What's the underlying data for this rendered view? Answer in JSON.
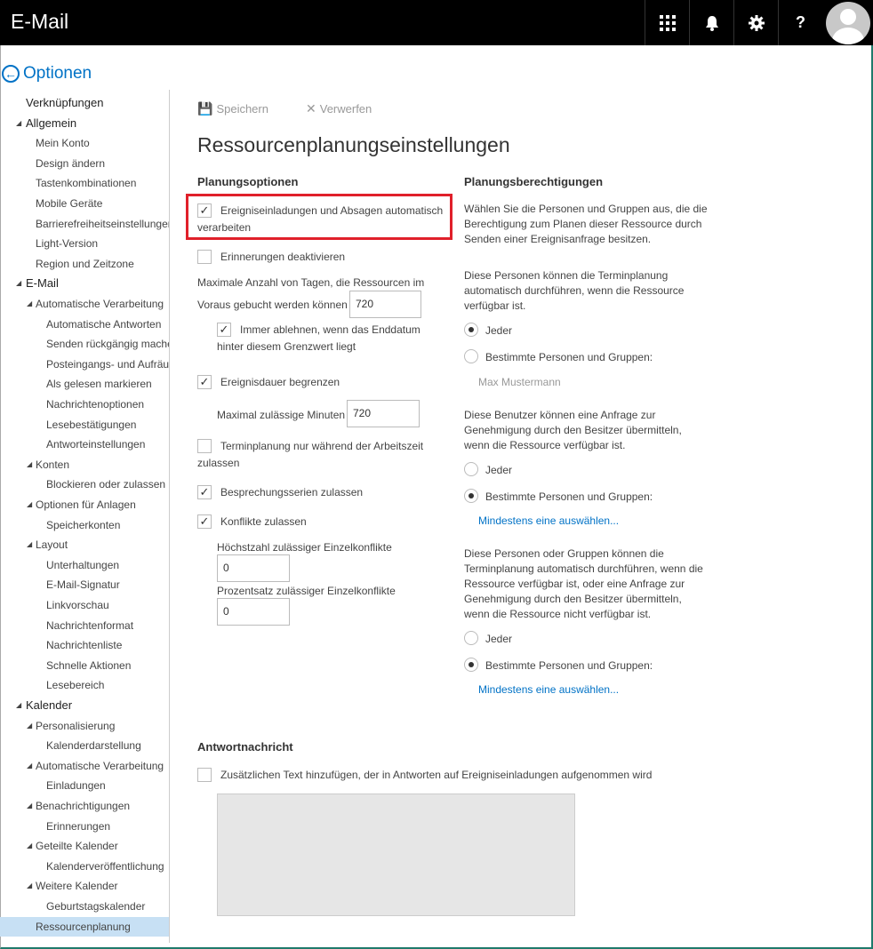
{
  "app": {
    "title": "E-Mail"
  },
  "topbar": {
    "icons": [
      "apps-icon",
      "bell-icon",
      "gear-icon",
      "help-icon",
      "avatar"
    ],
    "help_glyph": "?"
  },
  "header": {
    "back_label": "Optionen"
  },
  "sidebar": {
    "items": [
      {
        "label": "Verknüpfungen",
        "level": 0
      },
      {
        "label": "Allgemein",
        "level": 0,
        "expanded": true
      },
      {
        "label": "Mein Konto",
        "level": 1
      },
      {
        "label": "Design ändern",
        "level": 1
      },
      {
        "label": "Tastenkombinationen",
        "level": 1
      },
      {
        "label": "Mobile Geräte",
        "level": 1
      },
      {
        "label": "Barrierefreiheitseinstellungen",
        "level": 1
      },
      {
        "label": "Light-Version",
        "level": 1
      },
      {
        "label": "Region und Zeitzone",
        "level": 1
      },
      {
        "label": "E-Mail",
        "level": 0,
        "expanded": true
      },
      {
        "label": "Automatische Verarbeitung",
        "level": 1,
        "expanded": true
      },
      {
        "label": "Automatische Antworten",
        "level": 2
      },
      {
        "label": "Senden rückgängig machen",
        "level": 2
      },
      {
        "label": "Posteingangs- und Aufräumregeln",
        "level": 2
      },
      {
        "label": "Als gelesen markieren",
        "level": 2
      },
      {
        "label": "Nachrichtenoptionen",
        "level": 2
      },
      {
        "label": "Lesebestätigungen",
        "level": 2
      },
      {
        "label": "Antworteinstellungen",
        "level": 2
      },
      {
        "label": "Konten",
        "level": 1,
        "expanded": true
      },
      {
        "label": "Blockieren oder zulassen",
        "level": 2
      },
      {
        "label": "Optionen für Anlagen",
        "level": 1,
        "expanded": true
      },
      {
        "label": "Speicherkonten",
        "level": 2
      },
      {
        "label": "Layout",
        "level": 1,
        "expanded": true
      },
      {
        "label": "Unterhaltungen",
        "level": 2
      },
      {
        "label": "E-Mail-Signatur",
        "level": 2
      },
      {
        "label": "Linkvorschau",
        "level": 2
      },
      {
        "label": "Nachrichtenformat",
        "level": 2
      },
      {
        "label": "Nachrichtenliste",
        "level": 2
      },
      {
        "label": "Schnelle Aktionen",
        "level": 2
      },
      {
        "label": "Lesebereich",
        "level": 2
      },
      {
        "label": "Kalender",
        "level": 0,
        "expanded": true
      },
      {
        "label": "Personalisierung",
        "level": 1,
        "expanded": true
      },
      {
        "label": "Kalenderdarstellung",
        "level": 2
      },
      {
        "label": "Automatische Verarbeitung",
        "level": 1,
        "expanded": true
      },
      {
        "label": "Einladungen",
        "level": 2
      },
      {
        "label": "Benachrichtigungen",
        "level": 1,
        "expanded": true
      },
      {
        "label": "Erinnerungen",
        "level": 2
      },
      {
        "label": "Geteilte Kalender",
        "level": 1,
        "expanded": true
      },
      {
        "label": "Kalenderveröffentlichung",
        "level": 2
      },
      {
        "label": "Weitere Kalender",
        "level": 1,
        "expanded": true
      },
      {
        "label": "Geburtstagskalender",
        "level": 2
      },
      {
        "label": "Ressourcenplanung",
        "level": 1,
        "selected": true
      }
    ]
  },
  "toolbar": {
    "save_label": "Speichern",
    "discard_label": "Verwerfen"
  },
  "main": {
    "title": "Ressourcenplanungseinstellungen",
    "planning": {
      "heading": "Planungsoptionen",
      "auto_process_line1": "Ereigniseinladungen und Absagen automatisch",
      "auto_process_line2": "verarbeiten",
      "auto_process_checked": true,
      "disable_reminders": "Erinnerungen deaktivieren",
      "disable_reminders_checked": false,
      "max_days_line1": "Maximale Anzahl von Tagen, die Ressourcen im",
      "max_days_line2": "Voraus gebucht werden können",
      "max_days_value": "720",
      "always_decline_line1": "Immer ablehnen, wenn das Enddatum",
      "always_decline_line2": "hinter diesem Grenzwert liegt",
      "always_decline_checked": true,
      "limit_duration": "Ereignisdauer begrenzen",
      "limit_duration_checked": true,
      "max_minutes_label": "Maximal zulässige Minuten",
      "max_minutes_value": "720",
      "work_hours_line1": "Terminplanung nur während der Arbeitszeit",
      "work_hours_line2": "zulassen",
      "work_hours_checked": false,
      "recurring": "Besprechungsserien zulassen",
      "recurring_checked": true,
      "conflicts": "Konflikte zulassen",
      "conflicts_checked": true,
      "max_conflicts_label": "Höchstzahl zulässiger Einzelkonflikte",
      "max_conflicts_value": "0",
      "percent_conflicts_label": "Prozentsatz zulässiger Einzelkonflikte",
      "percent_conflicts_value": "0"
    },
    "permissions": {
      "heading": "Planungsberechtigungen",
      "intro_1": "Wählen Sie die Personen und Gruppen aus, die die",
      "intro_2": "Berechtigung zum Planen dieser Ressource durch",
      "intro_3": "Senden einer Ereignisanfrage besitzen.",
      "g1_1": "Diese Personen können die Terminplanung",
      "g1_2": "automatisch durchführen, wenn die Ressource",
      "g1_3": "verfügbar ist.",
      "g1_opt1": "Jeder",
      "g1_opt2": "Bestimmte Personen und Gruppen:",
      "g1_selected": "Jeder",
      "g1_person": "Max Mustermann",
      "g2_1": "Diese Benutzer können eine Anfrage zur",
      "g2_2": "Genehmigung durch den Besitzer übermitteln,",
      "g2_3": "wenn die Ressource verfügbar ist.",
      "g2_opt1": "Jeder",
      "g2_opt2": "Bestimmte Personen und Gruppen:",
      "g2_selected": "Bestimmte Personen und Gruppen:",
      "g2_link": "Mindestens eine auswählen...",
      "g3_1": "Diese Personen oder Gruppen können die",
      "g3_2": "Terminplanung automatisch durchführen, wenn die",
      "g3_3": "Ressource verfügbar ist, oder eine Anfrage zur",
      "g3_4": "Genehmigung durch den Besitzer übermitteln,",
      "g3_5": "wenn die Ressource nicht verfügbar ist.",
      "g3_opt1": "Jeder",
      "g3_opt2": "Bestimmte Personen und Gruppen:",
      "g3_selected": "Bestimmte Personen und Gruppen:",
      "g3_link": "Mindestens eine auswählen..."
    },
    "reply": {
      "heading": "Antwortnachricht",
      "add_text": "Zusätzlichen Text hinzufügen, der in Antworten auf Ereigniseinladungen aufgenommen wird",
      "add_text_checked": false
    }
  },
  "colors": {
    "accent": "#0072c6",
    "highlight_box": "#e0202a",
    "selected_nav": "#c7e0f4",
    "topbar": "#000000"
  }
}
